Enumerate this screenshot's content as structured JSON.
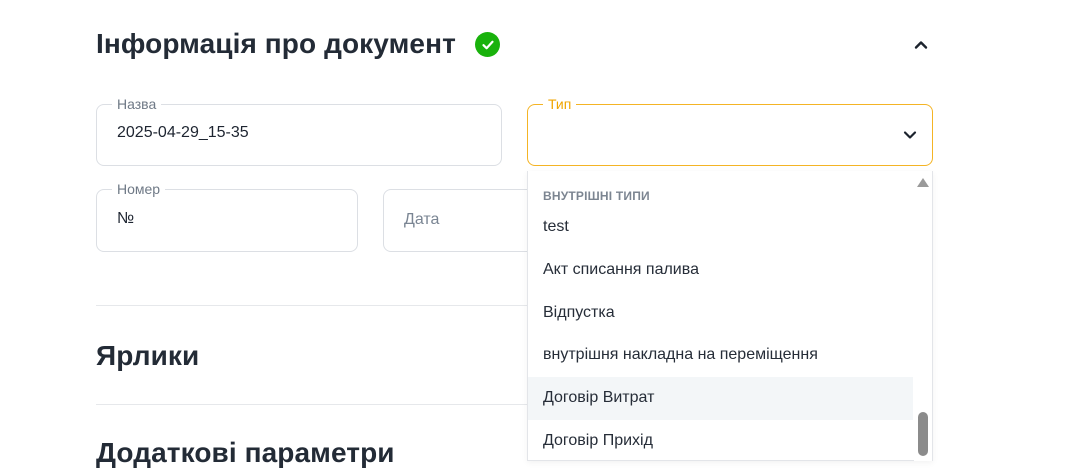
{
  "section": {
    "title": "Інформація про документ"
  },
  "fields": {
    "name": {
      "label": "Назва",
      "value": "2025-04-29_15-35"
    },
    "type": {
      "label": "Тип",
      "value": ""
    },
    "number": {
      "label": "Номер",
      "value": "№"
    },
    "date": {
      "placeholder": "Дата"
    }
  },
  "dropdown": {
    "group_header": "ВНУТРІШНІ ТИПИ",
    "options": [
      "test",
      "Акт списання палива",
      "Відпустка",
      "внутрішня накладна на переміщення",
      "Договір Витрат",
      "Договір Прихід"
    ],
    "hovered_index": 4
  },
  "sections": {
    "labels_title": "Ярлики",
    "extra_title": "Додаткові параметри"
  },
  "colors": {
    "accent": "#f4b425",
    "success": "#19b20c"
  }
}
